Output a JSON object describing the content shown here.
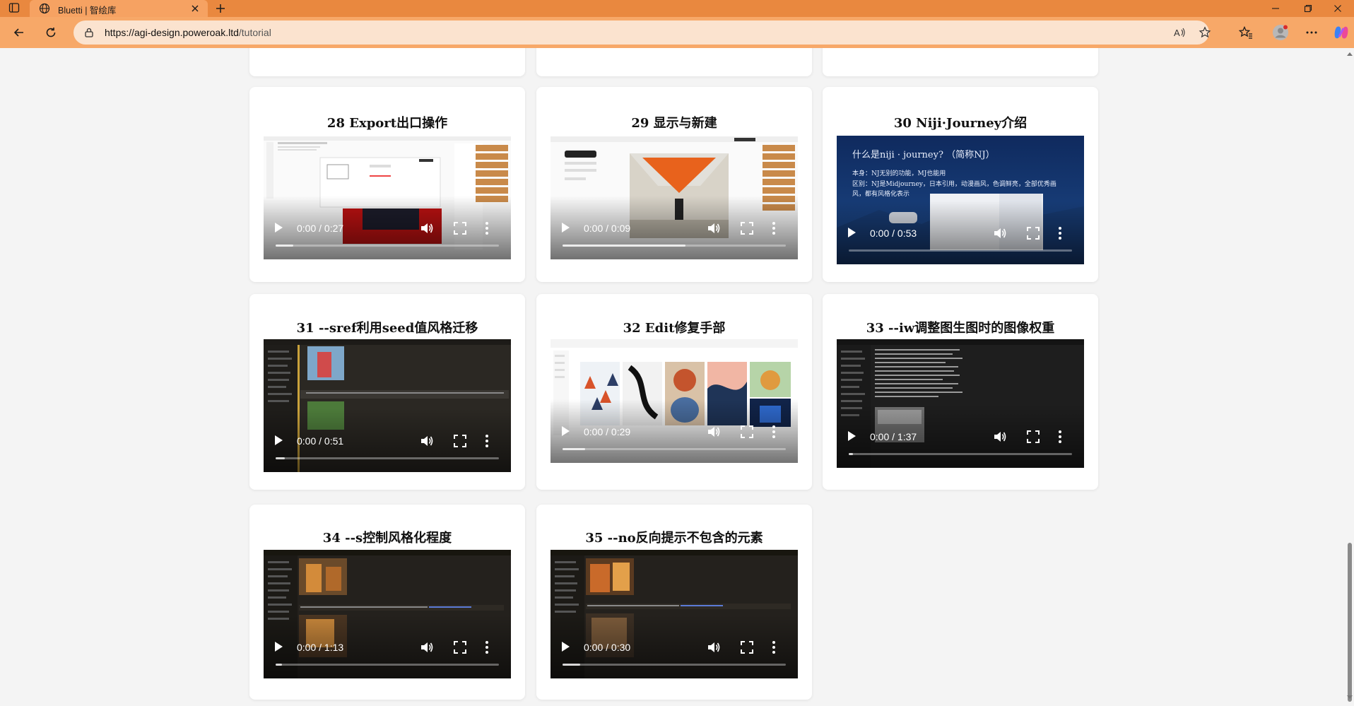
{
  "browser": {
    "tab_title": "Bluetti | 智绘库",
    "url_host": "https://agi-design.poweroak.ltd",
    "url_path": "/tutorial",
    "accent": "#e9883f"
  },
  "videos": [
    {
      "id": "28",
      "title": "28 Export出口操作",
      "time": "0:00 / 0:27",
      "buffered": 0.08,
      "theme": "light-ui"
    },
    {
      "id": "29",
      "title": "29 显示与新建",
      "time": "0:00 / 0:09",
      "buffered": 0.55,
      "theme": "light-ui"
    },
    {
      "id": "30",
      "title": "30 Niji·Journey介绍",
      "time": "0:00 / 0:53",
      "buffered": 0.0,
      "theme": "blue-slide",
      "slide_lines": [
        "什么是niji · journey? （简称NJ）",
        "本身：NJ无别的功能，MJ也能用",
        "区别：NJ是Midjourney，日本引用，动漫画风，色调鲜亮，全部优秀画风，都有风格化表示"
      ]
    },
    {
      "id": "31",
      "title": "31 --sref利用seed值风格迁移",
      "time": "0:00 / 0:51",
      "buffered": 0.04,
      "theme": "dark-ui"
    },
    {
      "id": "32",
      "title": "32 Edit修复手部",
      "time": "0:00 / 0:29",
      "buffered": 0.1,
      "theme": "gallery"
    },
    {
      "id": "33",
      "title": "33 --iw调整图生图时的图像权重",
      "time": "0:00 / 1:37",
      "buffered": 0.02,
      "theme": "dark-text"
    },
    {
      "id": "34",
      "title": "34 --s控制风格化程度",
      "time": "0:00 / 1:13",
      "buffered": 0.03,
      "theme": "dark-ui"
    },
    {
      "id": "35",
      "title": "35 --no反向提示不包含的元素",
      "time": "0:00 / 0:30",
      "buffered": 0.08,
      "theme": "dark-ui"
    }
  ]
}
